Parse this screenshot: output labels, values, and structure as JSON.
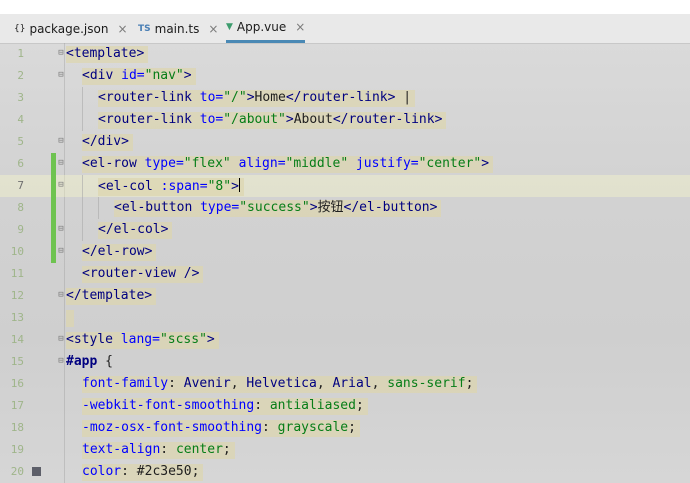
{
  "tabs": [
    {
      "icon": "{}",
      "label": "package.json",
      "close": "×"
    },
    {
      "icon": "TS",
      "label": "main.ts",
      "close": "×"
    },
    {
      "icon": "▼",
      "label": "App.vue",
      "close": "×"
    }
  ],
  "editor": {
    "current_line": 7,
    "line_numbers": [
      "1",
      "2",
      "3",
      "4",
      "5",
      "6",
      "7",
      "8",
      "9",
      "10",
      "11",
      "12",
      "13",
      "14",
      "15",
      "16",
      "17",
      "18",
      "19",
      "20"
    ]
  },
  "code": {
    "l1": {
      "t1": "<template>"
    },
    "l2": {
      "t1": "<div ",
      "a1": "id",
      "eq": "=",
      "s1": "\"nav\"",
      "t2": ">"
    },
    "l3": {
      "t1": "<router-link ",
      "a1": "to",
      "eq": "=",
      "s1": "\"/\"",
      "t2": ">",
      "x1": "Home",
      "t3": "</router-link>",
      "x2": " |"
    },
    "l4": {
      "t1": "<router-link ",
      "a1": "to",
      "eq": "=",
      "s1": "\"/about\"",
      "t2": ">",
      "x1": "About",
      "t3": "</router-link>"
    },
    "l5": {
      "t1": "</div>"
    },
    "l6": {
      "t1": "<el-row ",
      "a1": "type",
      "s1": "\"flex\"",
      "a2": "align",
      "s2": "\"middle\"",
      "a3": "justify",
      "s3": "\"center\"",
      "t2": ">",
      "eq": "="
    },
    "l7": {
      "t1": "<el-col ",
      "a1": ":span",
      "eq": "=",
      "s1": "\"8\"",
      "t2": ">"
    },
    "l8": {
      "t1": "<el-button ",
      "a1": "type",
      "eq": "=",
      "s1": "\"success\"",
      "t2": ">",
      "x1": "按钮",
      "t3": "</el-button>"
    },
    "l9": {
      "t1": "</el-col>"
    },
    "l10": {
      "t1": "</el-row>"
    },
    "l11": {
      "t1": "<router-view />"
    },
    "l12": {
      "t1": "</template>"
    },
    "l14": {
      "t1": "<style ",
      "a1": "lang",
      "eq": "=",
      "s1": "\"scss\"",
      "t2": ">"
    },
    "l15": {
      "sel": "#app",
      "brace": " {"
    },
    "l16": {
      "p": "font-family",
      "c": ": ",
      "v1": "Avenir",
      "cm": ", ",
      "v2": "Helvetica",
      "v3": "Arial",
      "v4": "sans-serif",
      "semi": ";"
    },
    "l17": {
      "p": "-webkit-font-smoothing",
      "c": ": ",
      "v": "antialiased",
      "semi": ";"
    },
    "l18": {
      "p": "-moz-osx-font-smoothing",
      "c": ": ",
      "v": "grayscale",
      "semi": ";"
    },
    "l19": {
      "p": "text-align",
      "c": ": ",
      "v": "center",
      "semi": ";"
    },
    "l20": {
      "p": "color",
      "c": ": ",
      "v": "#2c3e50",
      "semi": ";"
    }
  },
  "colors": {
    "tag": "#000080",
    "attribute": "#0000ff",
    "string": "#067d17",
    "change_marker": "#6ec350",
    "active_tab_underline": "#4a89b5"
  }
}
